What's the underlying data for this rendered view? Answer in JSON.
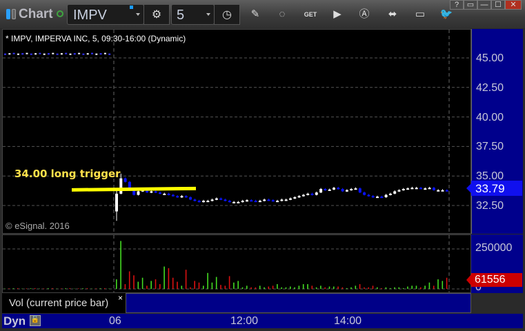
{
  "titlebar": {
    "app_title": "Chart",
    "symbol": "IMPV",
    "interval": "5",
    "tools": [
      "pencil-icon",
      "chart-refresh-icon",
      "get-icon",
      "play-icon",
      "a-circle-icon",
      "link-icon",
      "comment-icon",
      "twitter-icon"
    ],
    "window_buttons": [
      "?",
      "▭",
      "—",
      "☐",
      "✕"
    ]
  },
  "chart": {
    "legend": "* IMPV, IMPERVA INC, 5, 09:30-16:00 (Dynamic)",
    "copyright": "© eSignal. 2016",
    "annotation": "34.00 long trigger",
    "trigger_price": 34.0,
    "price_ticks": [
      "45.00",
      "42.50",
      "40.00",
      "37.50",
      "35.00",
      "32.50"
    ],
    "last_price": "33.79",
    "prev_day_price": 45.4,
    "first_open": 32.0,
    "closes": [
      33.5,
      34.8,
      34.5,
      33.8,
      33.4,
      33.7,
      33.8,
      33.6,
      33.7,
      33.6,
      33.5,
      33.5,
      33.4,
      33.3,
      33.2,
      33.3,
      33.2,
      33.0,
      32.9,
      32.8,
      32.9,
      32.9,
      33.0,
      33.1,
      33.0,
      32.9,
      32.8,
      32.8,
      32.8,
      32.9,
      32.95,
      32.9,
      32.85,
      32.9,
      33.0,
      32.95,
      32.9,
      32.9,
      33.0,
      33.0,
      33.1,
      33.2,
      33.3,
      33.4,
      33.5,
      33.4,
      33.6,
      33.9,
      33.8,
      33.85,
      34.0,
      33.9,
      33.7,
      33.8,
      33.9,
      33.95,
      33.6,
      33.4,
      33.3,
      33.2,
      33.25,
      33.2,
      33.4,
      33.5,
      33.7,
      33.8,
      33.9,
      33.95,
      34.0,
      34.0,
      33.95,
      33.95,
      34.0,
      33.8,
      33.8,
      33.8,
      33.79
    ],
    "volumes_k": [
      60,
      300,
      30,
      110,
      85,
      45,
      70,
      20,
      50,
      60,
      30,
      140,
      130,
      70,
      45,
      20,
      120,
      10,
      50,
      40,
      20,
      100,
      40,
      75,
      25,
      20,
      80,
      40,
      50,
      10,
      20,
      10,
      10,
      20,
      10,
      15,
      20,
      30,
      10,
      10,
      15,
      10,
      20,
      30,
      30,
      20,
      10,
      20,
      10,
      15,
      15,
      15,
      10,
      5,
      10,
      20,
      30,
      10,
      10,
      20,
      10,
      5,
      10,
      5,
      10,
      10,
      5,
      15,
      20,
      20,
      10,
      20,
      40,
      20,
      60,
      50,
      70,
      120,
      62
    ],
    "vol_ticks": [
      "250000",
      "0"
    ],
    "vol_last": "61556",
    "vol_study_label": "Vol (current price bar)",
    "close_study": "×",
    "colors": {
      "up": "#ffffff",
      "down": "#0a14ff",
      "vol_up": "#44dd22",
      "vol_down": "#dd1111",
      "trigger": "#ffff00"
    }
  },
  "timebar": {
    "mode": "Dyn",
    "labels": [
      "06",
      "12:00",
      "14:00"
    ]
  }
}
